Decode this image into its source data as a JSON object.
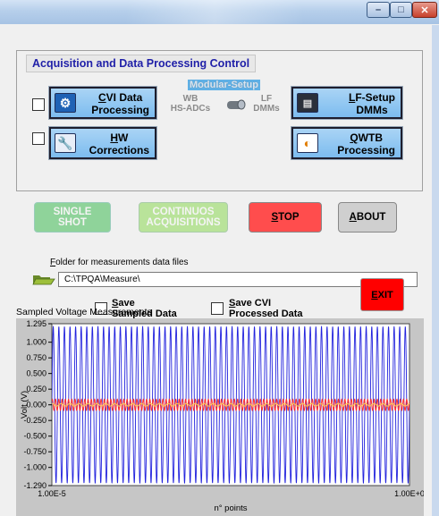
{
  "window": {
    "min_glyph": "–",
    "max_glyph": "□",
    "close_glyph": "✕"
  },
  "group": {
    "title": "Acquisition and Data Processing Control",
    "modular_setup": "Modular-Setup",
    "wb_label": "WB\nHS-ADCs",
    "lf_label": "LF\nDMMs"
  },
  "buttons": {
    "cvi_accel": "C",
    "cvi_rest": "VI Data",
    "cvi_line2": "Processing",
    "hw_accel": "H",
    "hw_rest": "W",
    "hw_line2": "Corrections",
    "lf_accel": "L",
    "lf_rest": "F-Setup",
    "lf_line2": "DMMs",
    "qwtb_accel": "Q",
    "qwtb_rest": "WTB",
    "qwtb_line2": "Processing",
    "single_line1": "SINGLE",
    "single_line2": "SHOT",
    "continuos_line1": "CONTINUOS",
    "continuos_line2": "ACQUISITIONS",
    "stop_accel": "S",
    "stop_rest": "TOP",
    "about_accel": "A",
    "about_rest": "BOUT",
    "exit_accel": "E",
    "exit_rest": "XIT"
  },
  "folder": {
    "label_accel": "F",
    "label_rest": "older for measurements data files",
    "path": "C:\\TPQA\\Measure\\"
  },
  "save": {
    "sampled_accel": "S",
    "sampled_rest": "ave",
    "sampled_line2": "Sampled Data",
    "cvi_accel": "S",
    "cvi_rest": "ave CVI",
    "cvi_line2": "Processed Data"
  },
  "chart_data": {
    "type": "line",
    "title": "Sampled Voltage Measurements",
    "xlabel": "n° points",
    "ylabel": "Volt (V)",
    "xlim_labels": [
      "1.00E-5",
      "1.00E+0"
    ],
    "ylim": [
      -1.29,
      1.295
    ],
    "yticks": [
      "1.295",
      "1.000",
      "0.750",
      "0.500",
      "0.250",
      "0.000",
      "-0.250",
      "-0.500",
      "-0.750",
      "-1.000",
      "-1.290"
    ],
    "ytick_values": [
      1.295,
      1.0,
      0.75,
      0.5,
      0.25,
      0.0,
      -0.25,
      -0.5,
      -0.75,
      -1.0,
      -1.29
    ],
    "grid": false,
    "series": [
      {
        "color": "#2222dd",
        "amplitude": 1.25,
        "cycles": 64
      },
      {
        "color": "#ff3030",
        "amplitude": 0.09,
        "cycles": 110
      },
      {
        "color": "#ffd24d",
        "amplitude": 0.02,
        "cycles": 40
      }
    ]
  },
  "colors": {
    "title_blue": "#1f1fa8",
    "button_blue": "#8ec6f2",
    "green_disabled": "#8fd39a",
    "stop_red": "#ff4d4d",
    "exit_red": "#ff0000",
    "about_grey": "#cfcfcf"
  }
}
